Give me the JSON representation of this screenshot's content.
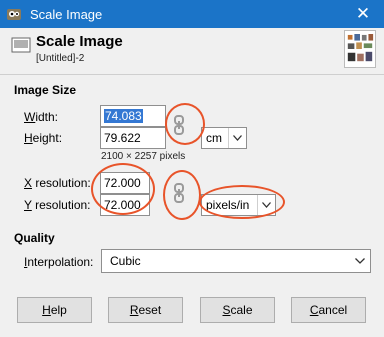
{
  "window": {
    "title": "Scale Image",
    "close_glyph": "✕"
  },
  "header": {
    "title": "Scale Image",
    "subtitle": "[Untitled]-2"
  },
  "image_size": {
    "section_title": "Image Size",
    "width_label_u": "W",
    "width_label_rest": "idth:",
    "width_value": "74.083",
    "height_label_u": "H",
    "height_label_rest": "eight:",
    "height_value": "79.622",
    "unit": "cm",
    "pixel_info": "2100 × 2257 pixels",
    "x_res_label_u": "X",
    "x_res_label_rest": " resolution:",
    "x_res_value": "72.000",
    "y_res_label_u": "Y",
    "y_res_label_rest": " resolution:",
    "y_res_value": "72.000",
    "res_unit": "pixels/in"
  },
  "quality": {
    "section_title": "Quality",
    "interp_label_u": "I",
    "interp_label_rest": "nterpolation:",
    "interp_value": "Cubic"
  },
  "buttons": {
    "help_u": "H",
    "help_rest": "elp",
    "reset_u": "R",
    "reset_rest": "eset",
    "scale_u": "S",
    "scale_rest": "cale",
    "cancel_u": "C",
    "cancel_rest": "ancel"
  },
  "colors": {
    "titlebar": "#1b74c8",
    "annotation": "#e8542a",
    "selection": "#3478d3"
  },
  "icons": {
    "app": "gimp-icon",
    "doc": "image-icon",
    "chain": "chain-link-icon",
    "dropdown": "chevron-down-icon"
  }
}
